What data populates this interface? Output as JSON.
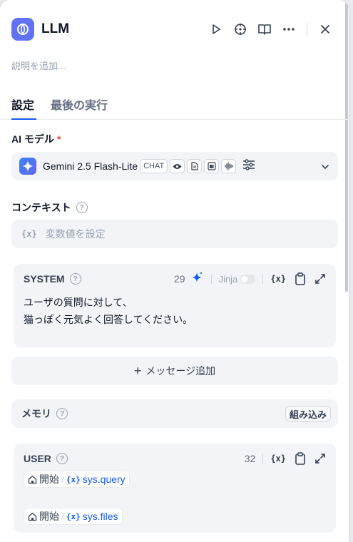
{
  "header": {
    "title": "LLM"
  },
  "description_placeholder": "説明を追加...",
  "tabs": [
    {
      "label": "設定"
    },
    {
      "label": "最後の実行"
    }
  ],
  "model_section": {
    "label": "AI モデル",
    "required_mark": "*",
    "model_name": "Gemini 2.5 Flash-Lite",
    "mode_tag": "CHAT",
    "capability_icons": [
      "vision-icon",
      "document-icon",
      "video-icon",
      "audio-icon"
    ]
  },
  "context_section": {
    "label": "コンテキスト",
    "placeholder": "変数値を設定",
    "var_glyph": "{x}"
  },
  "system_prompt": {
    "role": "SYSTEM",
    "token_count": "29",
    "jinja_label": "Jinja",
    "jinja_enabled": false,
    "var_glyph": "{x}",
    "lines": [
      "ユーザの質問に対して、",
      "猫っぽく元気よく回答してください。"
    ]
  },
  "add_message": {
    "plus": "+",
    "label": "メッセージ追加"
  },
  "memory_section": {
    "label": "メモリ",
    "builtin_label": "組み込み"
  },
  "user_prompt": {
    "role": "USER",
    "token_count": "32",
    "var_glyph": "{x}",
    "variables": [
      {
        "node": "開始",
        "sep": "/",
        "glyph": "{x}",
        "var": "sys.query"
      },
      {
        "node": "開始",
        "sep": "/",
        "glyph": "{x}",
        "var": "sys.files"
      }
    ]
  },
  "colors": {
    "accent": "#155aef",
    "app_icon": "#6172f3",
    "required": "#f04438"
  }
}
